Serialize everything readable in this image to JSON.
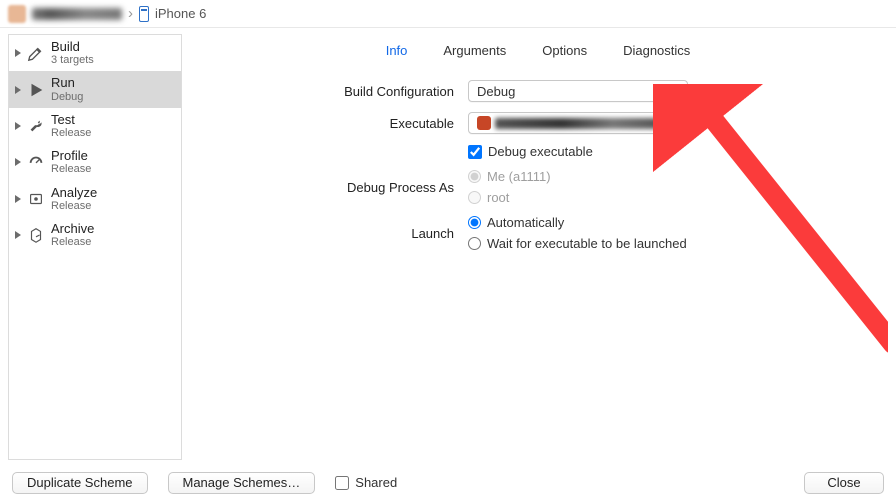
{
  "breadcrumb": {
    "device": "iPhone 6"
  },
  "sidebar": {
    "items": [
      {
        "label": "Build",
        "sub": "3 targets"
      },
      {
        "label": "Run",
        "sub": "Debug"
      },
      {
        "label": "Test",
        "sub": "Release"
      },
      {
        "label": "Profile",
        "sub": "Release"
      },
      {
        "label": "Analyze",
        "sub": "Release"
      },
      {
        "label": "Archive",
        "sub": "Release"
      }
    ],
    "selected_index": 1
  },
  "tabs": {
    "items": [
      "Info",
      "Arguments",
      "Options",
      "Diagnostics"
    ],
    "active_index": 0
  },
  "form": {
    "build_config_label": "Build Configuration",
    "build_config_value": "Debug",
    "executable_label": "Executable",
    "debug_exec_label": "Debug executable",
    "debug_exec_checked": true,
    "debug_process_label": "Debug Process As",
    "debug_process_me": "Me (a1111)",
    "debug_process_root": "root",
    "launch_label": "Launch",
    "launch_auto": "Automatically",
    "launch_wait": "Wait for executable to be launched"
  },
  "footer": {
    "duplicate": "Duplicate Scheme",
    "manage": "Manage Schemes…",
    "shared": "Shared",
    "close": "Close"
  }
}
